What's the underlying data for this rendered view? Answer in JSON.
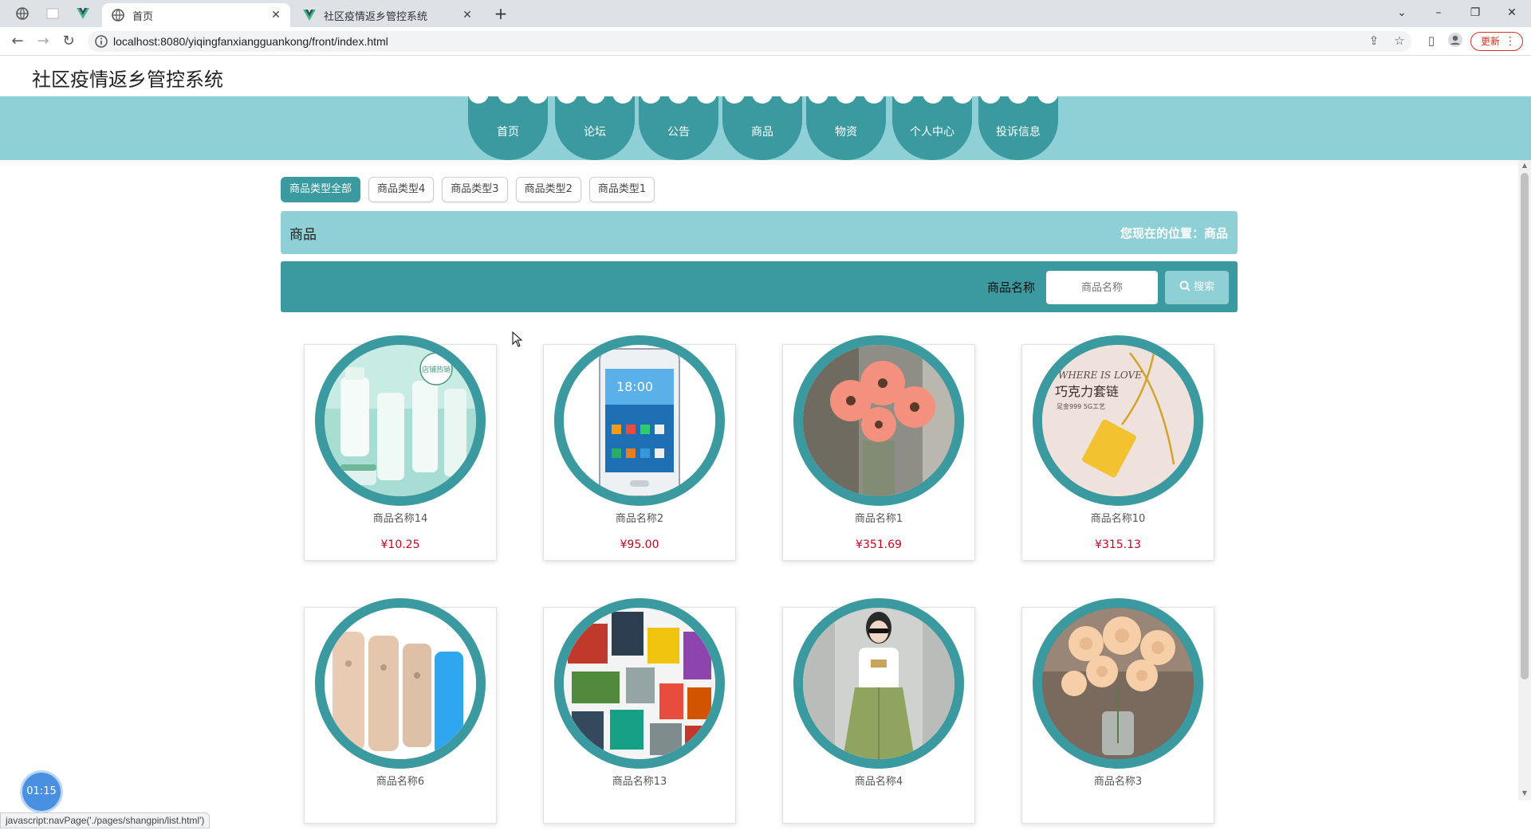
{
  "browser": {
    "tabs": [
      {
        "title": "首页",
        "active": true
      },
      {
        "title": "社区疫情返乡管控系统",
        "active": false
      }
    ],
    "url": "localhost:8080/yiqingfanxiangguankong/front/index.html",
    "update_label": "更新"
  },
  "site": {
    "title": "社区疫情返乡管控系统"
  },
  "nav": {
    "items": [
      "首页",
      "论坛",
      "公告",
      "商品",
      "物资",
      "个人中心",
      "投诉信息"
    ]
  },
  "categories": {
    "items": [
      "商品类型全部",
      "商品类型4",
      "商品类型3",
      "商品类型2",
      "商品类型1"
    ],
    "active": "商品类型全部"
  },
  "section": {
    "title": "商品",
    "location": "您现在的位置：商品"
  },
  "search": {
    "label": "商品名称",
    "placeholder": "商品名称",
    "button": "搜索"
  },
  "products": [
    {
      "name": "商品名称14",
      "price": "¥10.25",
      "image": "cosmetics-bottles"
    },
    {
      "name": "商品名称2",
      "price": "¥95.00",
      "image": "smartphone"
    },
    {
      "name": "商品名称1",
      "price": "¥351.69",
      "image": "pink-flowers"
    },
    {
      "name": "商品名称10",
      "price": "¥315.13",
      "image": "gold-necklace"
    },
    {
      "name": "商品名称6",
      "price": "",
      "image": "iphones"
    },
    {
      "name": "商品名称13",
      "price": "",
      "image": "perfume-collage"
    },
    {
      "name": "商品名称4",
      "price": "",
      "image": "woman-skirt"
    },
    {
      "name": "商品名称3",
      "price": "",
      "image": "peach-roses"
    }
  ],
  "product_image_text": {
    "necklace_caption": "WHERE IS LOVE",
    "necklace_title": "巧克力套链",
    "necklace_sub": "足金999   5G工艺",
    "phone_time": "18:00",
    "cosmetics_stamp": "店铺热销"
  },
  "timer": "01:15",
  "status_text": "javascript:navPage('./pages/shangpin/list.html')",
  "colors": {
    "teal_dark": "#3a9a9f",
    "teal_light": "#8fcfd6",
    "price_red": "#d0021b"
  }
}
